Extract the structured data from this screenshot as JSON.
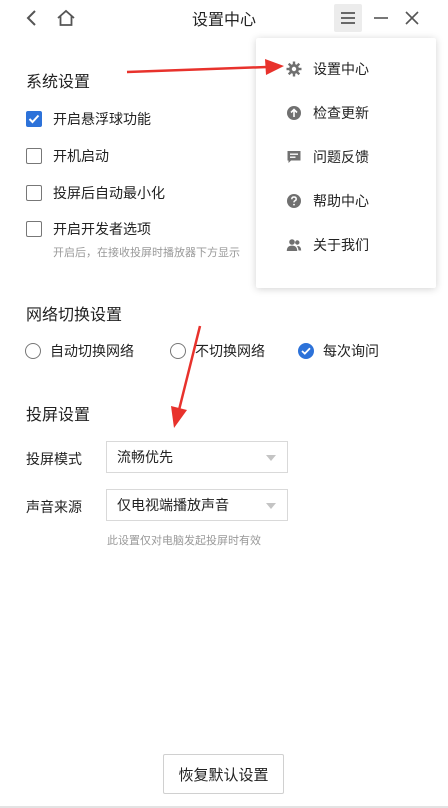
{
  "window": {
    "title": "设置中心",
    "buttons": {
      "back": "back-icon",
      "home": "home-icon",
      "menu": "menu-icon",
      "minimize": "minimize-icon",
      "close": "close-icon"
    }
  },
  "system_settings": {
    "title": "系统设置",
    "options": [
      {
        "label": "开启悬浮球功能",
        "checked": true
      },
      {
        "label": "开机启动",
        "checked": false
      },
      {
        "label": "投屏后自动最小化",
        "checked": false
      },
      {
        "label": "开启开发者选项",
        "checked": false
      }
    ],
    "developer_hint": "开启后，在接收投屏时播放器下方显示"
  },
  "network_settings": {
    "title": "网络切换设置",
    "options": [
      {
        "label": "自动切换网络",
        "selected": false
      },
      {
        "label": "不切换网络",
        "selected": false
      },
      {
        "label": "每次询问",
        "selected": true
      }
    ]
  },
  "cast_settings": {
    "title": "投屏设置",
    "mode_label": "投屏模式",
    "mode_value": "流畅优先",
    "audio_label": "声音来源",
    "audio_value": "仅电视端播放声音",
    "audio_hint": "此设置仅对电脑发起投屏时有效"
  },
  "reset_button": "恢复默认设置",
  "menu": {
    "items": [
      {
        "label": "设置中心",
        "icon": "gear-icon"
      },
      {
        "label": "检查更新",
        "icon": "update-arrow-icon"
      },
      {
        "label": "问题反馈",
        "icon": "feedback-icon"
      },
      {
        "label": "帮助中心",
        "icon": "help-icon"
      },
      {
        "label": "关于我们",
        "icon": "users-icon"
      }
    ]
  },
  "colors": {
    "accent": "#2d72d9",
    "annotation_arrow": "#e8322c",
    "icon_gray": "#707070"
  }
}
